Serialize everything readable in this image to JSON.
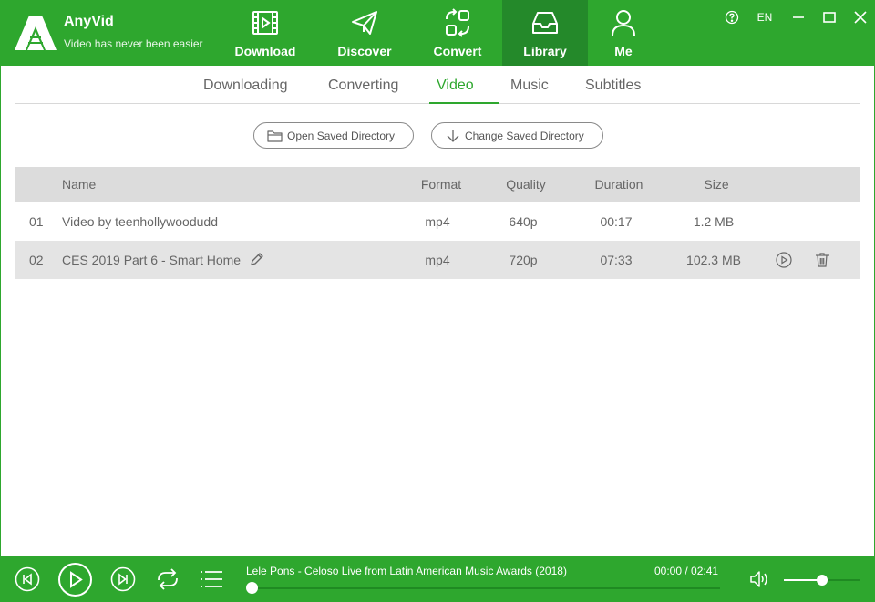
{
  "app": {
    "name": "AnyVid",
    "tagline": "Video has never been easier"
  },
  "nav": {
    "items": [
      {
        "label": "Download",
        "icon": "film-icon"
      },
      {
        "label": "Discover",
        "icon": "paper-plane-icon"
      },
      {
        "label": "Convert",
        "icon": "convert-icon"
      },
      {
        "label": "Library",
        "icon": "inbox-tray-icon",
        "active": true
      },
      {
        "label": "Me",
        "icon": "user-icon"
      }
    ]
  },
  "window": {
    "help": "?",
    "language": "EN"
  },
  "subtabs": {
    "items": [
      "Downloading",
      "Converting",
      "Video",
      "Music",
      "Subtitles"
    ],
    "active": "Video"
  },
  "directory": {
    "open_label": "Open Saved Directory",
    "change_label": "Change Saved Directory"
  },
  "table": {
    "headers": {
      "name": "Name",
      "format": "Format",
      "quality": "Quality",
      "duration": "Duration",
      "size": "Size"
    },
    "rows": [
      {
        "index": "01",
        "name": "Video by teenhollywoodudd",
        "format": "mp4",
        "quality": "640p",
        "duration": "00:17",
        "size": "1.2 MB"
      },
      {
        "index": "02",
        "name": "CES 2019 Part 6 - Smart Home",
        "format": "mp4",
        "quality": "720p",
        "duration": "07:33",
        "size": "102.3 MB"
      }
    ]
  },
  "player": {
    "title": "Lele Pons - Celoso Live from Latin American Music Awards (2018)",
    "time": "00:00 / 02:41",
    "progress": 0,
    "volume": 0.5
  },
  "colors": {
    "brand": "#2ea72e",
    "brand_dark": "#24892a",
    "header_row": "#dcdcdc",
    "selected_row": "#e4e4e4"
  }
}
